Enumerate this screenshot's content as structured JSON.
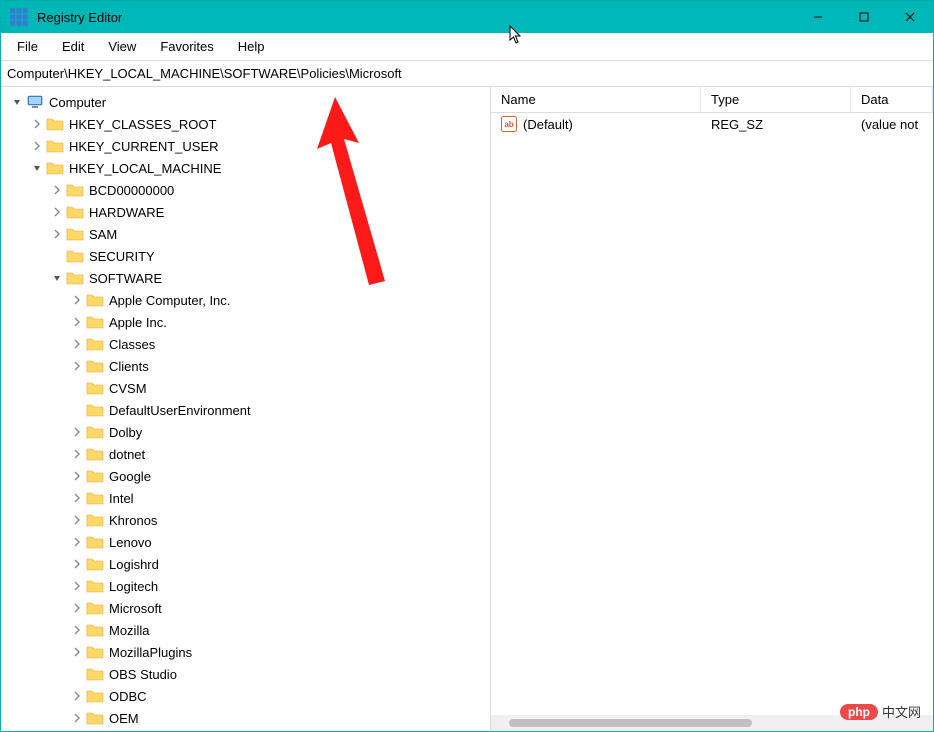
{
  "window_title": "Registry Editor",
  "menu": [
    "File",
    "Edit",
    "View",
    "Favorites",
    "Help"
  ],
  "address": "Computer\\HKEY_LOCAL_MACHINE\\SOFTWARE\\Policies\\Microsoft",
  "tree": [
    {
      "depth": 0,
      "expand": "open",
      "icon": "computer",
      "label": "Computer"
    },
    {
      "depth": 1,
      "expand": "closed",
      "icon": "folder",
      "label": "HKEY_CLASSES_ROOT"
    },
    {
      "depth": 1,
      "expand": "closed",
      "icon": "folder",
      "label": "HKEY_CURRENT_USER"
    },
    {
      "depth": 1,
      "expand": "open",
      "icon": "folder",
      "label": "HKEY_LOCAL_MACHINE"
    },
    {
      "depth": 2,
      "expand": "closed",
      "icon": "folder",
      "label": "BCD00000000"
    },
    {
      "depth": 2,
      "expand": "closed",
      "icon": "folder",
      "label": "HARDWARE"
    },
    {
      "depth": 2,
      "expand": "closed",
      "icon": "folder",
      "label": "SAM"
    },
    {
      "depth": 2,
      "expand": "none",
      "icon": "folder",
      "label": "SECURITY"
    },
    {
      "depth": 2,
      "expand": "open",
      "icon": "folder",
      "label": "SOFTWARE"
    },
    {
      "depth": 3,
      "expand": "closed",
      "icon": "folder",
      "label": "Apple Computer, Inc."
    },
    {
      "depth": 3,
      "expand": "closed",
      "icon": "folder",
      "label": "Apple Inc."
    },
    {
      "depth": 3,
      "expand": "closed",
      "icon": "folder",
      "label": "Classes"
    },
    {
      "depth": 3,
      "expand": "closed",
      "icon": "folder",
      "label": "Clients"
    },
    {
      "depth": 3,
      "expand": "none",
      "icon": "folder",
      "label": "CVSM",
      "dotted": true
    },
    {
      "depth": 3,
      "expand": "none",
      "icon": "folder",
      "label": "DefaultUserEnvironment",
      "dotted": true
    },
    {
      "depth": 3,
      "expand": "closed",
      "icon": "folder",
      "label": "Dolby"
    },
    {
      "depth": 3,
      "expand": "closed",
      "icon": "folder",
      "label": "dotnet"
    },
    {
      "depth": 3,
      "expand": "closed",
      "icon": "folder",
      "label": "Google"
    },
    {
      "depth": 3,
      "expand": "closed",
      "icon": "folder",
      "label": "Intel"
    },
    {
      "depth": 3,
      "expand": "closed",
      "icon": "folder",
      "label": "Khronos"
    },
    {
      "depth": 3,
      "expand": "closed",
      "icon": "folder",
      "label": "Lenovo"
    },
    {
      "depth": 3,
      "expand": "closed",
      "icon": "folder",
      "label": "Logishrd"
    },
    {
      "depth": 3,
      "expand": "closed",
      "icon": "folder",
      "label": "Logitech"
    },
    {
      "depth": 3,
      "expand": "closed",
      "icon": "folder",
      "label": "Microsoft"
    },
    {
      "depth": 3,
      "expand": "closed",
      "icon": "folder",
      "label": "Mozilla"
    },
    {
      "depth": 3,
      "expand": "closed",
      "icon": "folder",
      "label": "MozillaPlugins"
    },
    {
      "depth": 3,
      "expand": "none",
      "icon": "folder",
      "label": "OBS Studio",
      "dotted": true
    },
    {
      "depth": 3,
      "expand": "closed",
      "icon": "folder",
      "label": "ODBC"
    },
    {
      "depth": 3,
      "expand": "closed",
      "icon": "folder",
      "label": "OEM"
    }
  ],
  "list": {
    "headers": {
      "name": "Name",
      "type": "Type",
      "data": "Data"
    },
    "rows": [
      {
        "icon": "ab",
        "name": "(Default)",
        "type": "REG_SZ",
        "data": "(value not"
      }
    ]
  },
  "watermark": {
    "pill": "php",
    "text": "中文网"
  }
}
